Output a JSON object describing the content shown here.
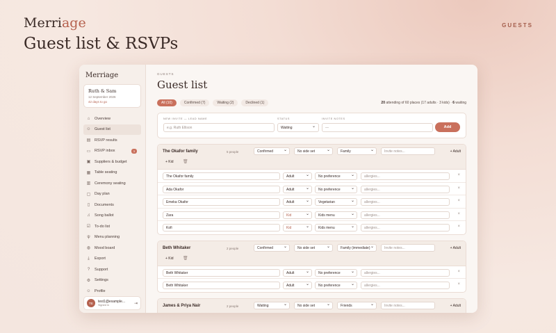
{
  "hero": {
    "brand_a": "Merri",
    "brand_b": "age",
    "title": "Guest list & RSVPs",
    "tag": "GUESTS"
  },
  "sidebar": {
    "brand": "Merriage",
    "couple": {
      "name": "Ruth & Sam",
      "date": "12 September 2026",
      "days": "42 days to go"
    },
    "items": [
      {
        "label": "Overview",
        "icon": "home-icon"
      },
      {
        "label": "Guest list",
        "icon": "users-icon"
      },
      {
        "label": "RSVP results",
        "icon": "chart-icon"
      },
      {
        "label": "RSVP inbox",
        "icon": "inbox-icon",
        "badge": "3"
      },
      {
        "label": "Suppliers & budget",
        "icon": "briefcase-icon"
      },
      {
        "label": "Table seating",
        "icon": "table-icon"
      },
      {
        "label": "Ceremony seating",
        "icon": "grid-icon"
      },
      {
        "label": "Day plan",
        "icon": "calendar-icon"
      },
      {
        "label": "Documents",
        "icon": "document-icon"
      },
      {
        "label": "Song ballot",
        "icon": "music-icon"
      },
      {
        "label": "To-do list",
        "icon": "checklist-icon"
      },
      {
        "label": "Menu planning",
        "icon": "utensils-icon"
      },
      {
        "label": "Mood board",
        "icon": "palette-icon"
      },
      {
        "label": "Export",
        "icon": "download-icon"
      },
      {
        "label": "Support",
        "icon": "help-icon"
      },
      {
        "label": "Settings",
        "icon": "gear-icon"
      },
      {
        "label": "Profile",
        "icon": "user-icon"
      }
    ],
    "user": {
      "initials": "TE",
      "email": "test1@example...",
      "sub": "Signed in"
    }
  },
  "main": {
    "eyebrow": "GUESTS",
    "title": "Guest list",
    "filters": [
      {
        "label": "All (10)",
        "active": true
      },
      {
        "label": "Confirmed (7)"
      },
      {
        "label": "Waiting (2)"
      },
      {
        "label": "Declined (1)"
      }
    ],
    "summary": {
      "attending": "20",
      "rest_a": " attending of 60 places (17 adults · 3 kids) · ",
      "waiting": "6",
      "rest_b": " waiting"
    },
    "new_invite": {
      "lead_label": "NEW INVITE — LEAD NAME",
      "lead_placeholder": "e.g. Ruth Ellison",
      "status_label": "STATUS",
      "status_value": "Waiting",
      "notes_label": "INVITE NOTES",
      "notes_placeholder": "—",
      "add_label": "Add"
    },
    "groups": [
      {
        "name": "The Okafor family",
        "count": "5 people",
        "status": "Confirmed",
        "side": "No side set",
        "relation": "Family",
        "notes_placeholder": "Invite notes...",
        "add_adult": "+ Adult",
        "add_kid": "+ Kid",
        "members": [
          {
            "name": "The Okafor family",
            "age": "Adult",
            "diet": "No preference",
            "allergies": "allergies..."
          },
          {
            "name": "Ada Okafor",
            "age": "Adult",
            "diet": "No preference",
            "allergies": "allergies..."
          },
          {
            "name": "Emeka Okafor",
            "age": "Adult",
            "diet": "Vegetarian",
            "allergies": "allergies..."
          },
          {
            "name": "Zara",
            "age": "Kid",
            "diet": "Kids menu",
            "allergies": "allergies..."
          },
          {
            "name": "Kofi",
            "age": "Kid",
            "diet": "Kids menu",
            "allergies": "allergies..."
          }
        ]
      },
      {
        "name": "Beth Whitaker",
        "count": "2 people",
        "status": "Confirmed",
        "side": "No side set",
        "relation": "Family (immediate)",
        "notes_placeholder": "Invite notes...",
        "add_adult": "+ Adult",
        "add_kid": "+ Kid",
        "members": [
          {
            "name": "Beth Whitaker",
            "age": "Adult",
            "diet": "No preference",
            "allergies": "allergies..."
          },
          {
            "name": "Beth Whitaker",
            "age": "Adult",
            "diet": "No preference",
            "allergies": "allergies..."
          }
        ]
      },
      {
        "name": "James & Priya Nair",
        "count": "2 people",
        "status": "Waiting",
        "side": "No side set",
        "relation": "Friends",
        "notes_placeholder": "Invite notes...",
        "add_adult": "+ Adult",
        "add_kid": "+ Kid",
        "members": []
      }
    ],
    "remove_glyph": "×",
    "trash_glyph": "🗑"
  }
}
